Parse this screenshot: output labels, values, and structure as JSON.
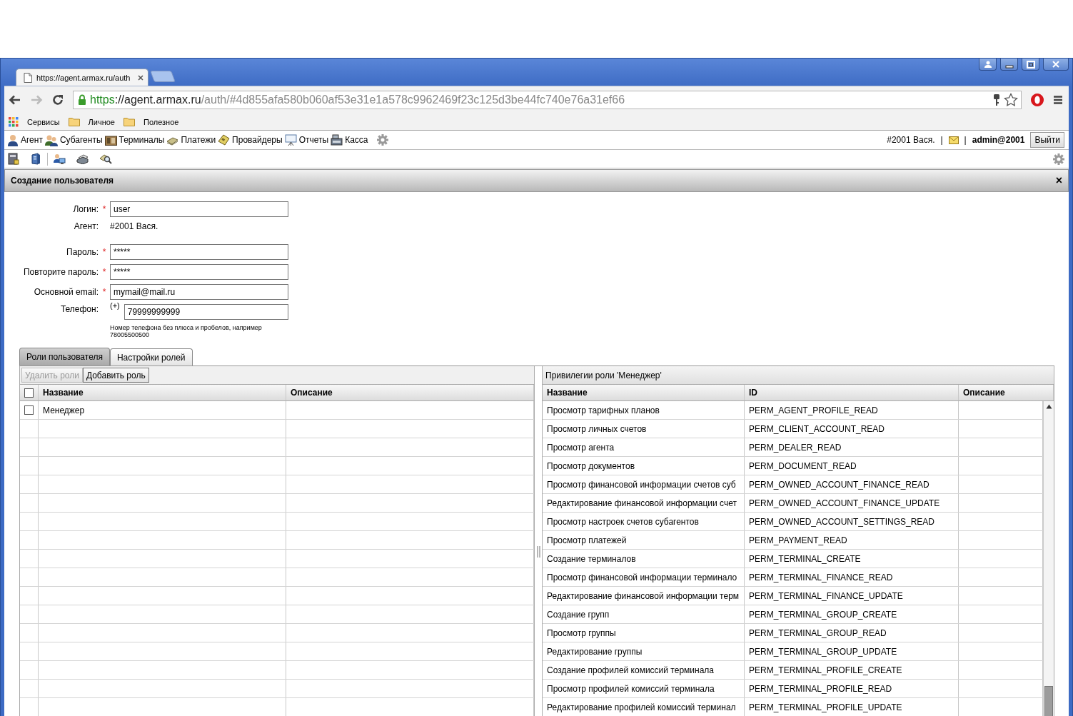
{
  "browser": {
    "tab_title": "https://agent.armax.ru/auth",
    "url": {
      "scheme": "https",
      "host": "://agent.armax.ru",
      "path": "/auth/#4d855afa580b060af53e31e1a578c9962469f23c125d3be44fc740e76a31ef66"
    },
    "bookmarks": [
      {
        "label": "Сервисы",
        "kind": "apps"
      },
      {
        "label": "Личное",
        "kind": "folder"
      },
      {
        "label": "Полезное",
        "kind": "folder"
      }
    ]
  },
  "menu": {
    "items": [
      "Агент",
      "Субагенты",
      "Терминалы",
      "Платежи",
      "Провайдеры",
      "Отчеты",
      "Касса"
    ],
    "agent": "#2001 Вася.",
    "separator_1": "|",
    "separator_2": "|",
    "user": "admin@2001",
    "logout": "Выйти"
  },
  "panel": {
    "title": "Создание пользователя",
    "close": "×"
  },
  "form": {
    "fields": [
      {
        "kind": "input",
        "label": "Логин:",
        "required_mark": "*",
        "value": "user"
      },
      {
        "kind": "text",
        "label": "Агент:",
        "value": "#2001 Вася."
      },
      {
        "kind": "input",
        "label": "Пароль:",
        "required_mark": "*",
        "value": "*****"
      },
      {
        "kind": "input",
        "label": "Повторите пароль:",
        "required_mark": "*",
        "value": "*****"
      },
      {
        "kind": "input",
        "label": "Основной email:",
        "required_mark": "*",
        "value": "mymail@mail.ru"
      },
      {
        "kind": "phone",
        "label": "Телефон:",
        "prefix": "(+)",
        "value": "79999999999",
        "hint": "Номер телефона без плюса и пробелов, например 78005500500"
      }
    ]
  },
  "tabs": [
    {
      "label": "Роли пользователя",
      "selected": true
    },
    {
      "label": "Настройки ролей",
      "selected": false
    }
  ],
  "roles": {
    "buttons": [
      {
        "label": "Удалить роли",
        "disabled": true
      },
      {
        "label": "Добавить роль",
        "disabled": false
      }
    ],
    "header_checked": false,
    "columns": [
      "Название",
      "Описание"
    ],
    "rows": [
      {
        "name": "Менеджер",
        "checked": false
      }
    ]
  },
  "privileges": {
    "title": "Привилегии роли 'Менеджер'",
    "columns": [
      "Название",
      "ID",
      "Описание"
    ],
    "rows": [
      {
        "name": "Просмотр тарифных планов",
        "id": "PERM_AGENT_PROFILE_READ"
      },
      {
        "name": "Просмотр личных счетов",
        "id": "PERM_CLIENT_ACCOUNT_READ"
      },
      {
        "name": "Просмотр агента",
        "id": "PERM_DEALER_READ"
      },
      {
        "name": "Просмотр документов",
        "id": "PERM_DOCUMENT_READ"
      },
      {
        "name": "Просмотр финансовой информации счетов суб",
        "id": "PERM_OWNED_ACCOUNT_FINANCE_READ"
      },
      {
        "name": "Редактирование финансовой информации счет",
        "id": "PERM_OWNED_ACCOUNT_FINANCE_UPDATE"
      },
      {
        "name": "Просмотр настроек счетов субагентов",
        "id": "PERM_OWNED_ACCOUNT_SETTINGS_READ"
      },
      {
        "name": "Просмотр платежей",
        "id": "PERM_PAYMENT_READ"
      },
      {
        "name": "Создание терминалов",
        "id": "PERM_TERMINAL_CREATE"
      },
      {
        "name": "Просмотр финансовой информации терминало",
        "id": "PERM_TERMINAL_FINANCE_READ"
      },
      {
        "name": "Редактирование финансовой информации терм",
        "id": "PERM_TERMINAL_FINANCE_UPDATE"
      },
      {
        "name": "Создание групп",
        "id": "PERM_TERMINAL_GROUP_CREATE"
      },
      {
        "name": "Просмотр группы",
        "id": "PERM_TERMINAL_GROUP_READ"
      },
      {
        "name": "Редактирование группы",
        "id": "PERM_TERMINAL_GROUP_UPDATE"
      },
      {
        "name": "Создание профилей комиссий терминала",
        "id": "PERM_TERMINAL_PROFILE_CREATE"
      },
      {
        "name": "Просмотр профилей комиссий терминала",
        "id": "PERM_TERMINAL_PROFILE_READ"
      },
      {
        "name": "Редактирование профилей комиссий терминал",
        "id": "PERM_TERMINAL_PROFILE_UPDATE"
      }
    ]
  }
}
